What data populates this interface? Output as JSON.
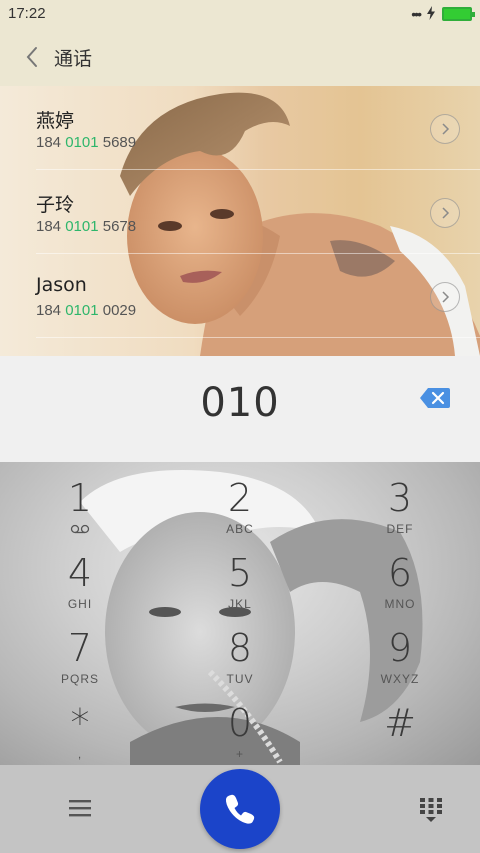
{
  "status_bar": {
    "time": "17:22",
    "dots": "•••"
  },
  "header": {
    "title": "通话"
  },
  "contacts": [
    {
      "name": "燕婷",
      "number_prefix": "184 ",
      "number_match": "0101",
      "number_suffix": " 5689"
    },
    {
      "name": "子玲",
      "number_prefix": "184 ",
      "number_match": "0101",
      "number_suffix": " 5678"
    },
    {
      "name": "Jason",
      "number_prefix": "184 ",
      "number_match": "0101",
      "number_suffix": " 0029"
    }
  ],
  "dial_input": {
    "value": "010"
  },
  "keypad": {
    "keys": [
      {
        "digit": "1",
        "letters": ""
      },
      {
        "digit": "2",
        "letters": "ABC"
      },
      {
        "digit": "3",
        "letters": "DEF"
      },
      {
        "digit": "4",
        "letters": "GHI"
      },
      {
        "digit": "5",
        "letters": "JKL"
      },
      {
        "digit": "6",
        "letters": "MNO"
      },
      {
        "digit": "7",
        "letters": "PQRS"
      },
      {
        "digit": "8",
        "letters": "TUV"
      },
      {
        "digit": "9",
        "letters": "WXYZ"
      },
      {
        "digit": "*",
        "letters": ","
      },
      {
        "digit": "0",
        "letters": "+"
      },
      {
        "digit": "#",
        "letters": ""
      }
    ]
  },
  "colors": {
    "accent_call": "#1b44c9",
    "match_highlight": "#2eb66b",
    "backspace": "#4a90e2",
    "battery": "#33cc33"
  },
  "icons": {
    "back": "chevron-left-icon",
    "detail": "chevron-right-circle-icon",
    "backspace": "backspace-icon",
    "voicemail": "voicemail-icon",
    "menu": "menu-icon",
    "call": "phone-icon",
    "keypad_toggle": "keypad-collapse-icon"
  }
}
